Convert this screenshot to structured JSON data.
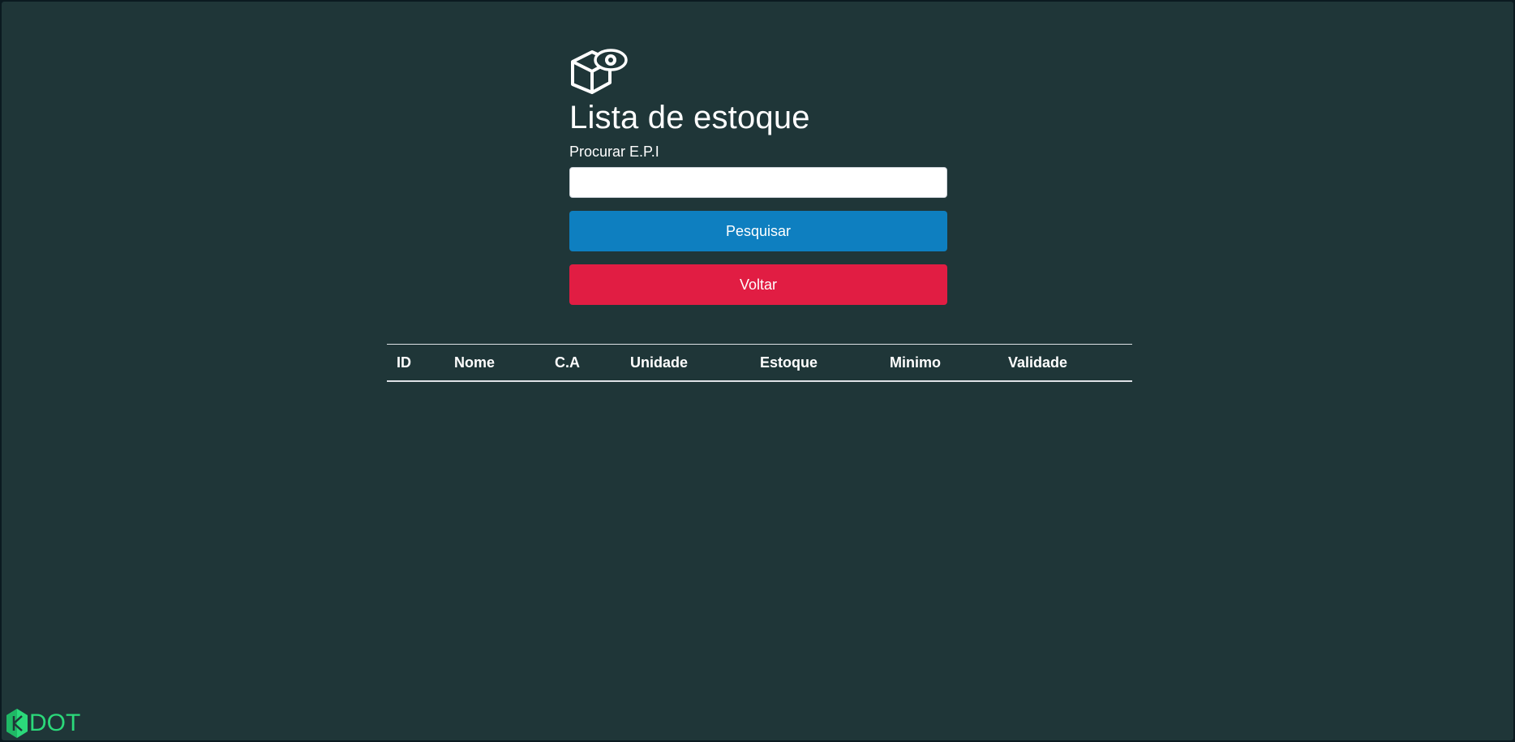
{
  "page": {
    "title": "Lista de estoque",
    "icon": "box-eye-icon"
  },
  "search": {
    "label": "Procurar E.P.I",
    "value": "",
    "placeholder": ""
  },
  "buttons": {
    "search_label": "Pesquisar",
    "back_label": "Voltar"
  },
  "table": {
    "columns": [
      "ID",
      "Nome",
      "C.A",
      "Unidade",
      "Estoque",
      "Minimo",
      "Validade"
    ],
    "rows": []
  },
  "logo": {
    "text": "DOT",
    "icon": "kdot-logo-icon"
  },
  "colors": {
    "background": "#1f3638",
    "search_button": "#0e7fc0",
    "back_button": "#e11d43",
    "logo": "#2bd97a"
  }
}
